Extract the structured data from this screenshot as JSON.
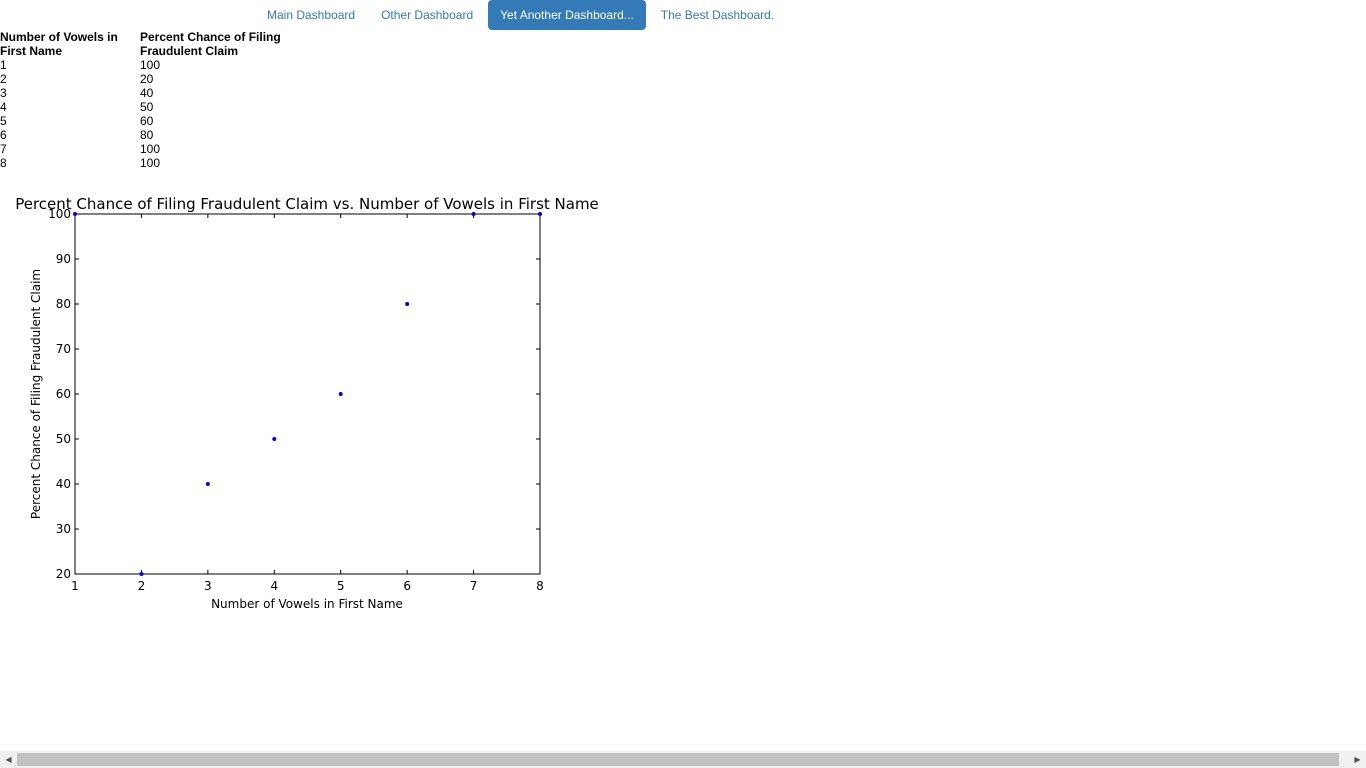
{
  "nav": {
    "tabs": [
      {
        "label": "Main Dashboard",
        "active": false
      },
      {
        "label": "Other Dashboard",
        "active": false
      },
      {
        "label": "Yet Another Dashboard...",
        "active": true
      },
      {
        "label": "The Best Dashboard.",
        "active": false
      }
    ]
  },
  "table": {
    "headers": [
      "Number of Vowels in First Name",
      "Percent Chance of Filing Fraudulent Claim"
    ],
    "rows": [
      [
        "1",
        "100"
      ],
      [
        "2",
        "20"
      ],
      [
        "3",
        "40"
      ],
      [
        "4",
        "50"
      ],
      [
        "5",
        "60"
      ],
      [
        "6",
        "80"
      ],
      [
        "7",
        "100"
      ],
      [
        "8",
        "100"
      ]
    ]
  },
  "colors": {
    "accent": "#337ab7",
    "point": "#0000ff"
  },
  "chart_data": {
    "type": "scatter",
    "title": "Percent Chance of Filing Fraudulent Claim vs. Number of Vowels in First Name",
    "xlabel": "Number of Vowels in First Name",
    "ylabel": "Percent Chance of Filing Fraudulent Claim",
    "x": [
      1,
      2,
      3,
      4,
      5,
      6,
      7,
      8
    ],
    "y": [
      100,
      20,
      40,
      50,
      60,
      80,
      100,
      100
    ],
    "xlim": [
      1,
      8
    ],
    "ylim": [
      20,
      100
    ],
    "xticks": [
      "1",
      "2",
      "3",
      "4",
      "5",
      "6",
      "7",
      "8"
    ],
    "yticks": [
      "20",
      "30",
      "40",
      "50",
      "60",
      "70",
      "80",
      "90",
      "100"
    ],
    "grid": false
  },
  "scrollbar": {
    "left_icon": "arrow-left-icon",
    "right_icon": "arrow-right-icon"
  }
}
